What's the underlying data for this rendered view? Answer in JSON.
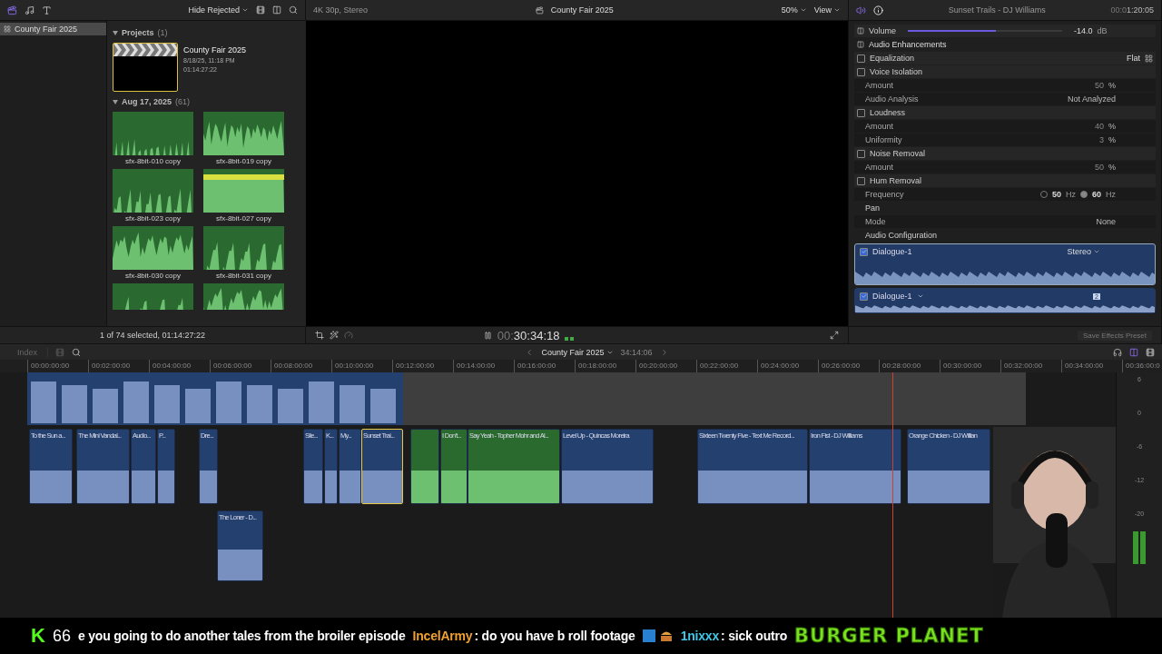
{
  "browser_toolbar": {
    "filter": "Hide Rejected"
  },
  "sidebar": {
    "items": [
      {
        "label": "County Fair 2025",
        "selected": true
      }
    ]
  },
  "browser": {
    "projects": {
      "title": "Projects",
      "count": "(1)",
      "expanded": true,
      "project": {
        "name": "County Fair 2025",
        "date": "8/18/25, 11:18 PM",
        "duration": "01:14:27:22"
      }
    },
    "event": {
      "title": "Aug 17, 2025",
      "count": "(61)",
      "expanded": true
    },
    "clips": [
      {
        "kind": "clip",
        "name": "sfx-8bit-010 copy"
      },
      {
        "kind": "clip",
        "name": "sfx-8bit-019 copy"
      },
      {
        "kind": "clip",
        "name": "sfx-8bit-023 copy"
      },
      {
        "kind": "clip",
        "name": "sfx-8bit-027 copy"
      },
      {
        "kind": "clip",
        "name": "sfx-8bit-030 copy"
      },
      {
        "kind": "clip",
        "name": "sfx-8bit-031 copy"
      },
      {
        "kind": "partial"
      },
      {
        "kind": "partial"
      }
    ],
    "status": "1 of 74 selected, 01:14:27:22"
  },
  "viewer": {
    "format": "4K 30p, Stereo",
    "title": "County Fair 2025",
    "zoom": "50%",
    "view": "View",
    "timecode_dim": "00:",
    "timecode": "30:34:18"
  },
  "inspector": {
    "title": "Sunset Trails - DJ Williams",
    "time_dim": "00:0",
    "time": "1:20:05",
    "rows": [
      {
        "kind": "slider",
        "label": "Volume",
        "level": 0.57,
        "reading": "-14.0",
        "unit": "dB"
      },
      {
        "kind": "section",
        "label": "Audio Enhancements"
      },
      {
        "kind": "check",
        "label": "Equalization",
        "checked": false,
        "value": "Flat"
      },
      {
        "kind": "check",
        "label": "Voice Isolation",
        "checked": false
      },
      {
        "kind": "param",
        "label": "Amount",
        "value": "50",
        "unit": "%"
      },
      {
        "kind": "param",
        "label": "Audio Analysis",
        "value": "Not Analyzed"
      },
      {
        "kind": "check",
        "label": "Loudness",
        "checked": false
      },
      {
        "kind": "param",
        "label": "Amount",
        "value": "40",
        "unit": "%"
      },
      {
        "kind": "param",
        "label": "Uniformity",
        "value": "3",
        "unit": "%"
      },
      {
        "kind": "check",
        "label": "Noise Removal",
        "checked": false
      },
      {
        "kind": "param",
        "label": "Amount",
        "value": "50",
        "unit": "%"
      },
      {
        "kind": "check",
        "label": "Hum Removal",
        "checked": false
      },
      {
        "kind": "radio",
        "label": "Frequency",
        "options": [
          {
            "value": "50",
            "unit": "Hz",
            "selected": false
          },
          {
            "value": "60",
            "unit": "Hz",
            "selected": true
          }
        ]
      },
      {
        "kind": "heading",
        "label": "Pan"
      },
      {
        "kind": "param",
        "label": "Mode",
        "value": "None"
      }
    ],
    "config_title": "Audio Configuration",
    "channels": [
      {
        "name": "Dialogue-1",
        "checked": true,
        "value": "Stereo",
        "selected": true
      },
      {
        "name": "Dialogue-1",
        "checked": true,
        "badge": "2",
        "selected": false
      }
    ],
    "preset_button": "Save Effects Preset"
  },
  "timeline": {
    "index": "Index",
    "project": "County Fair 2025",
    "duration": "34:14:06",
    "ruler": [
      "00:00:00:00",
      "00:02:00:00",
      "00:04:00:00",
      "00:06:00:00",
      "00:08:00:00",
      "00:10:00:00",
      "00:12:00:00",
      "00:14:00:00",
      "00:16:00:00",
      "00:18:00:00",
      "00:20:00:00",
      "00:22:00:00",
      "00:24:00:00",
      "00:26:00:00",
      "00:28:00:00",
      "00:30:00:00",
      "00:32:00:00",
      "00:34:00:00",
      "00:36:00:0"
    ],
    "clips": [
      {
        "name": "To the Sun a...",
        "kind": "audio",
        "selected": false
      },
      {
        "name": "The Mini Vandal...",
        "kind": "audio",
        "selected": false
      },
      {
        "name": "Audio...",
        "kind": "audio",
        "selected": false
      },
      {
        "name": "P...",
        "kind": "audio",
        "selected": false
      },
      {
        "name": "Dre...",
        "kind": "audio",
        "selected": false
      },
      {
        "name": "Sile...",
        "kind": "audio",
        "selected": false
      },
      {
        "name": "K...",
        "kind": "audio",
        "selected": false
      },
      {
        "name": "My...",
        "kind": "audio",
        "selected": false
      },
      {
        "name": "Sunset Trai...",
        "kind": "audio",
        "selected": true
      },
      {
        "kind": "music",
        "selected": false
      },
      {
        "name": "I Don't...",
        "kind": "music",
        "selected": false
      },
      {
        "name": "Say Yeah - Topher Mohr and Al...",
        "kind": "music",
        "selected": false
      },
      {
        "name": "Level Up - Quincas Moreira",
        "kind": "audio",
        "selected": false
      },
      {
        "name": "Sixteen Twenty Five - Text Me Record...",
        "kind": "audio",
        "selected": false
      },
      {
        "name": "Iron Fist - DJ Williams",
        "kind": "audio",
        "selected": false
      },
      {
        "name": "Orange Chicken - DJ Willian",
        "kind": "audio",
        "selected": false
      },
      {
        "name": "The Loner - D...",
        "kind": "audio",
        "selected": false
      }
    ],
    "meter_scale": [
      "6",
      "0",
      "-6",
      "-12",
      "-20"
    ]
  },
  "stream_overlay": {
    "logo": "K",
    "viewers": "66",
    "messages": [
      {
        "text": "e you going to do another tales from the broiler episode"
      },
      {
        "user": "IncelArmy",
        "color": "#f0a030",
        "text": ": do you have b roll footage",
        "emotes": true
      },
      {
        "user": "1nixxx",
        "color": "#40c8e8",
        "text": ": sick outro"
      }
    ],
    "banner": "BURGER PLANET"
  }
}
